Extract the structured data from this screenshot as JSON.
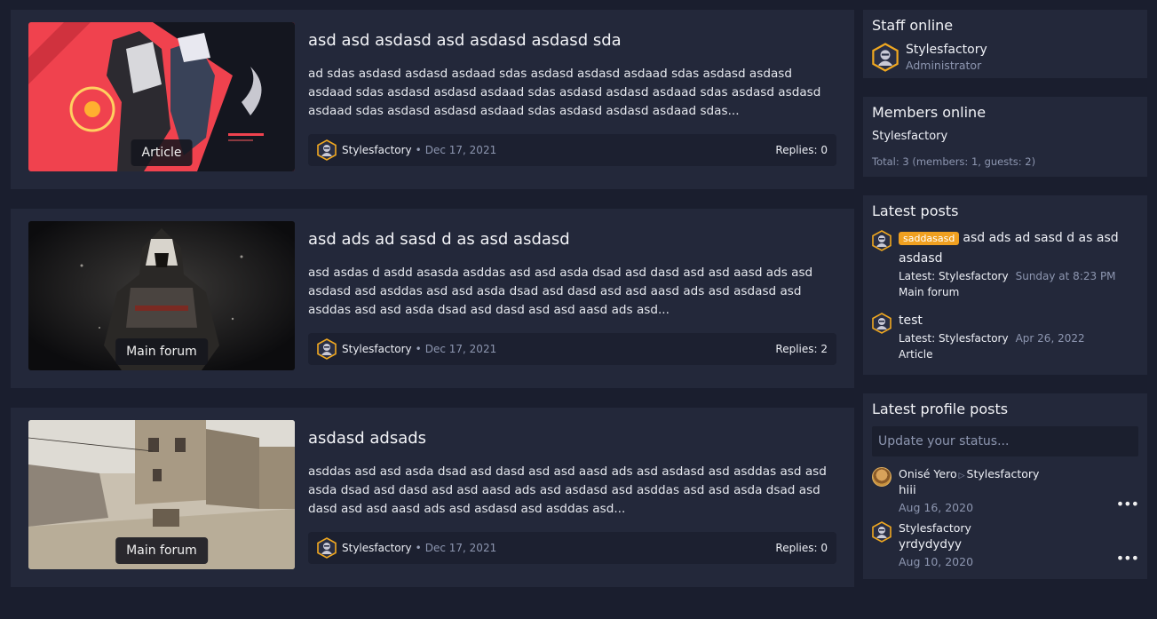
{
  "articles": [
    {
      "title": "asd asd asdasd asd asdasd asdasd sda",
      "snippet": "ad sdas asdasd asdasd asdaad sdas asdasd asdasd asdaad sdas asdasd asdasd asdaad sdas asdasd asdasd asdaad sdas asdasd asdasd asdaad sdas asdasd asdasd asdaad sdas asdasd asdasd asdaad sdas asdasd asdasd asdaad sdas...",
      "category": "Article",
      "author": "Stylesfactory",
      "date": "Dec 17, 2021",
      "replies": "Replies: 0"
    },
    {
      "title": "asd ads ad sasd d as asd asdasd",
      "snippet": "asd asdas d asdd asasda asddas asd asd asda dsad asd dasd asd asd aasd ads asd asdasd asd asddas asd asd asda dsad asd dasd asd asd aasd ads asd asdasd asd asddas asd asd asda dsad asd dasd asd asd aasd ads asd...",
      "category": "Main forum",
      "author": "Stylesfactory",
      "date": "Dec 17, 2021",
      "replies": "Replies: 2"
    },
    {
      "title": "asdasd adsads",
      "snippet": "asddas asd asd asda dsad asd dasd asd asd aasd ads asd asdasd asd asddas asd asd asda dsad asd dasd asd asd aasd ads asd asdasd asd asddas asd asd asda dsad asd dasd asd asd aasd ads asd asdasd asd asddas asd...",
      "category": "Main forum",
      "author": "Stylesfactory",
      "date": "Dec 17, 2021",
      "replies": "Replies: 0"
    }
  ],
  "sidebar": {
    "staff": {
      "heading": "Staff online",
      "name": "Stylesfactory",
      "role": "Administrator"
    },
    "members": {
      "heading": "Members online",
      "list": "Stylesfactory",
      "total": "Total: 3 (members: 1, guests: 2)"
    },
    "latest": {
      "heading": "Latest posts",
      "items": [
        {
          "prefix": "saddasasd",
          "title": "asd ads ad sasd d as asd asdasd",
          "latest": "Latest: Stylesfactory",
          "when": "Sunday at 8:23 PM",
          "forum": "Main forum"
        },
        {
          "title": "test",
          "latest": "Latest: Stylesfactory",
          "when": "Apr 26, 2022",
          "forum": "Article"
        }
      ]
    },
    "profile": {
      "heading": "Latest profile posts",
      "placeholder": "Update your status...",
      "items": [
        {
          "from": "Onisé Yero",
          "to": "Stylesfactory",
          "msg": "hiii",
          "date": "Aug 16, 2020",
          "more": "•••"
        },
        {
          "from": "Stylesfactory",
          "msg": "yrdydydyy",
          "date": "Aug 10, 2020",
          "more": "•••"
        }
      ]
    }
  },
  "colors": {
    "bg": "#1a1e2e",
    "panel": "#23283a",
    "accent": "#f0a020"
  },
  "icons": {
    "avatar": "hex-avatar-icon",
    "arrow": "triangle-right-icon",
    "more": "ellipsis-icon"
  }
}
